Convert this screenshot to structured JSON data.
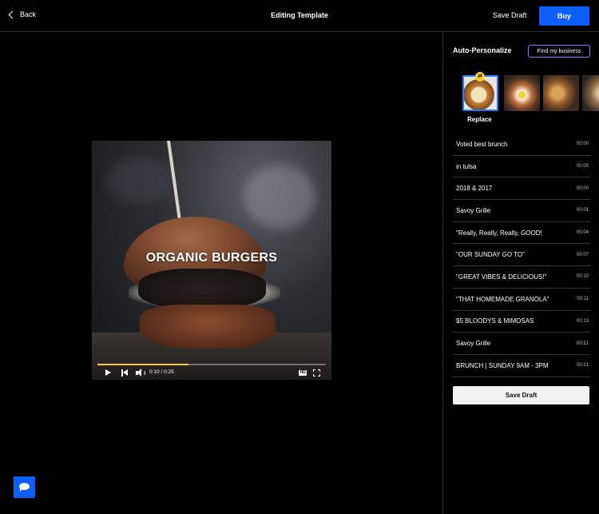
{
  "header": {
    "back_label": "Back",
    "title": "Editing Template",
    "save_draft_label": "Save Draft",
    "buy_label": "Buy"
  },
  "panel": {
    "title": "Auto-Personalize",
    "find_business_label": "Find my business",
    "replace_label": "Replace",
    "badge_icon": "swap-icon",
    "rows": [
      {
        "text": "Voted best brunch",
        "time": "00:00"
      },
      {
        "text": "in tulsa",
        "time": "00:00"
      },
      {
        "text": "2018 & 2017",
        "time": "00:00"
      },
      {
        "text": "Savoy Grille",
        "time": "00:01"
      },
      {
        "text": "\"Really, Really, Really, GOOD!",
        "time": "00:04"
      },
      {
        "text": "\"OUR SUNDAY GO TO\"",
        "time": "00:07"
      },
      {
        "text": "\"GREAT VIBES & DELICIOUS!\"",
        "time": "00:10"
      },
      {
        "text": "\"THAT HOMEMADE GRANOLA\"",
        "time": "00:11"
      },
      {
        "text": "$5 BLOODYS & MIMOSAS",
        "time": "00:13"
      },
      {
        "text": "Savoy Grille",
        "time": "00:21"
      },
      {
        "text": "BRUNCH | SUNDAY 9AM - 3PM",
        "time": "00:21"
      }
    ],
    "save_draft_label": "Save Draft"
  },
  "video": {
    "overlay_text": "ORGANIC BURGERS",
    "time_readout": "0:10 / 0:25",
    "progress": 0.4,
    "hd_label": "HD"
  },
  "colors": {
    "accent": "#0d5eff",
    "progress": "#f5d02b"
  }
}
